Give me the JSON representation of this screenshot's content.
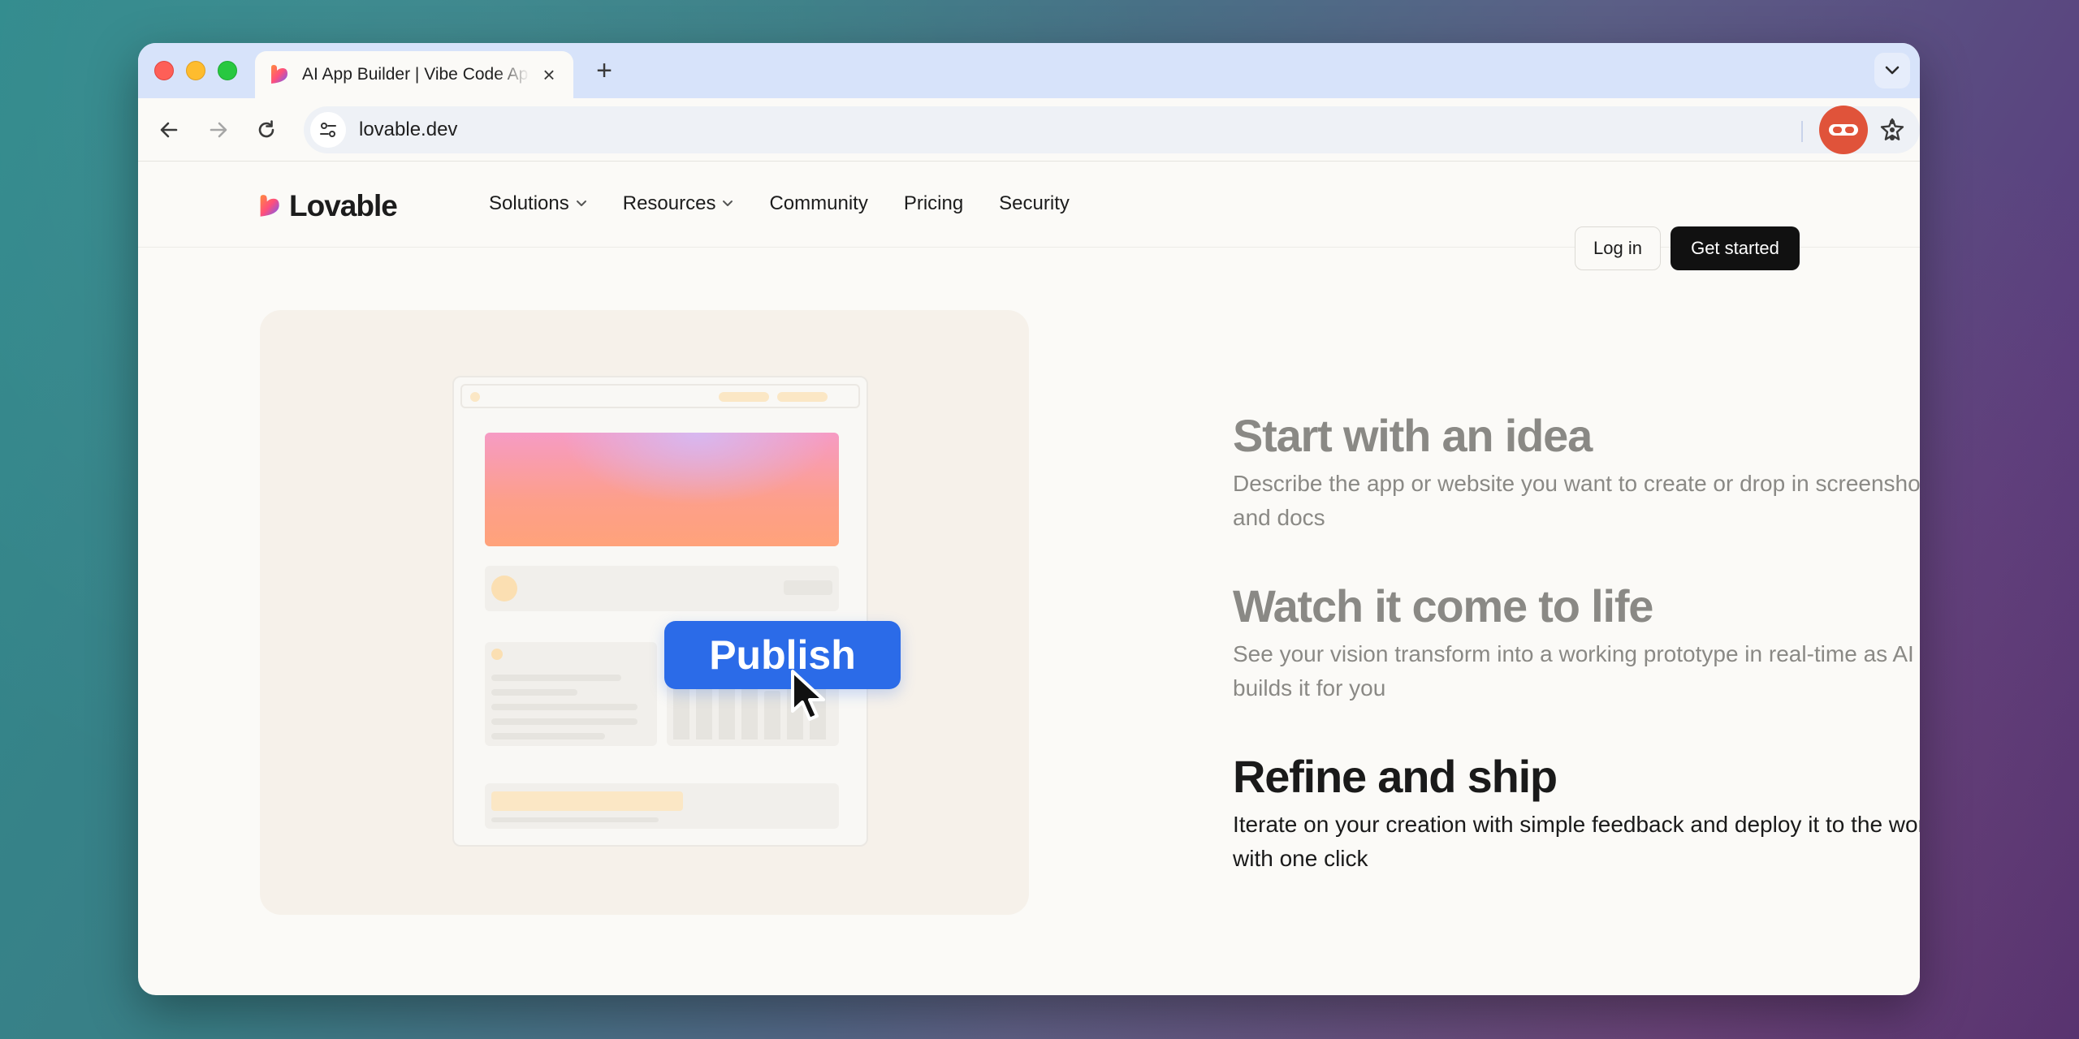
{
  "browser": {
    "tab_title": "AI App Builder | Vibe Code Apps",
    "url": "lovable.dev"
  },
  "site": {
    "brand": "Lovable",
    "nav": [
      {
        "label": "Solutions",
        "has_dropdown": true
      },
      {
        "label": "Resources",
        "has_dropdown": true
      },
      {
        "label": "Community",
        "has_dropdown": false
      },
      {
        "label": "Pricing",
        "has_dropdown": false
      },
      {
        "label": "Security",
        "has_dropdown": false
      }
    ],
    "login_label": "Log in",
    "cta_label": "Get started"
  },
  "illustration": {
    "publish_label": "Publish",
    "accent_color": "#2b6be8"
  },
  "steps": [
    {
      "title": "Start with an idea",
      "body": "Describe the app or website you want to create or drop in screenshots and docs",
      "active": false
    },
    {
      "title": "Watch it come to life",
      "body": "See your vision transform into a working prototype in real-time as AI builds it for you",
      "active": false
    },
    {
      "title": "Refine and ship",
      "body": "Iterate on your creation with simple feedback and deploy it to the world with one click",
      "active": true
    }
  ]
}
